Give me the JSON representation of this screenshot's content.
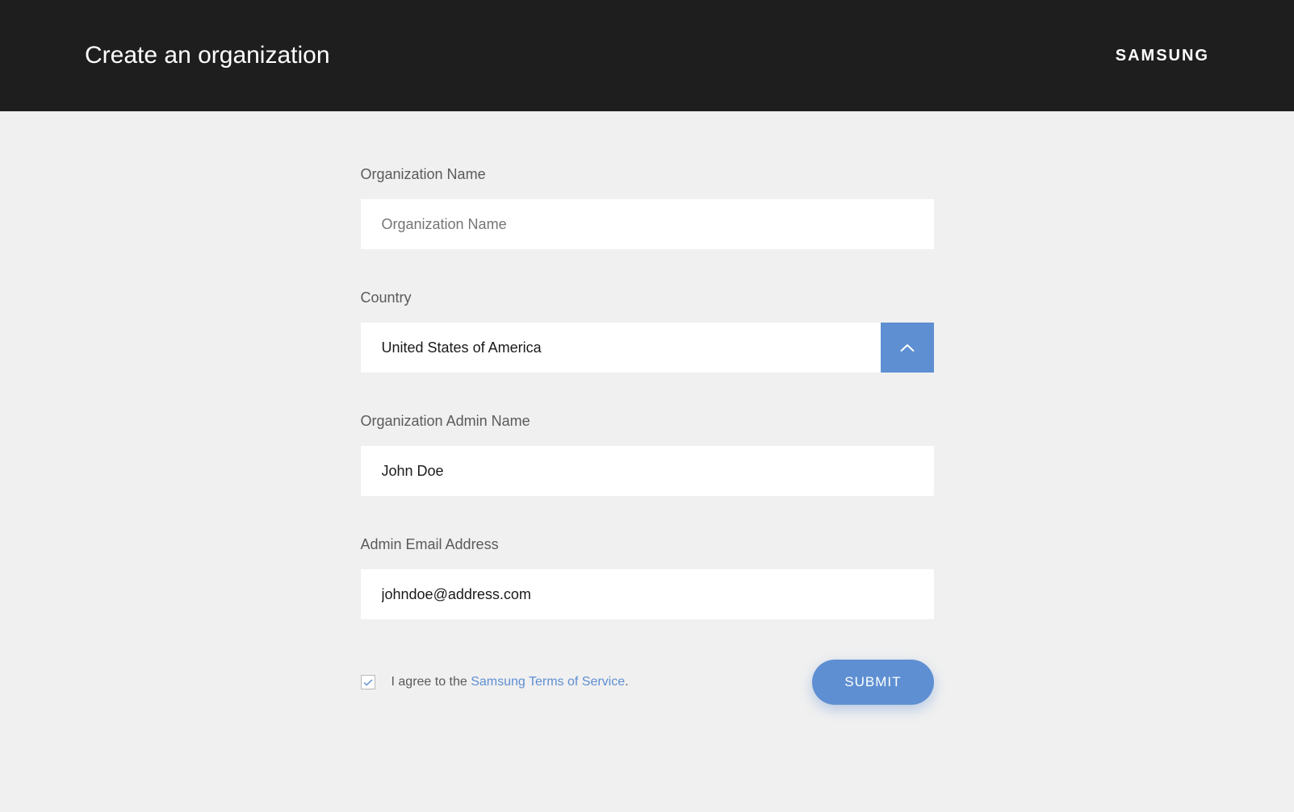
{
  "header": {
    "title": "Create an organization",
    "brand": "SAMSUNG"
  },
  "form": {
    "org_name": {
      "label": "Organization Name",
      "placeholder": "Organization Name",
      "value": ""
    },
    "country": {
      "label": "Country",
      "selected": "United States of America"
    },
    "admin_name": {
      "label": "Organization Admin Name",
      "value": "John Doe"
    },
    "admin_email": {
      "label": "Admin Email Address",
      "value": "johndoe@address.com"
    },
    "agreement": {
      "prefix": "I agree to the ",
      "link_text": "Samsung Terms of Service",
      "suffix": ".",
      "checked": true
    },
    "submit_label": "SUBMIT"
  }
}
